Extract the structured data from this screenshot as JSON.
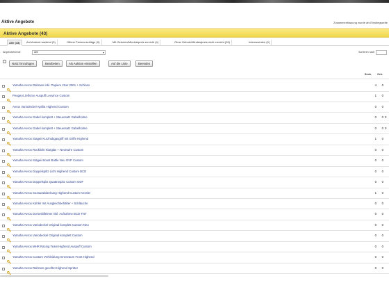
{
  "page": {
    "title": "Aktive Angebote",
    "summary_note": "Zusammenfassung wurde als Einstiegsseite"
  },
  "banner": {
    "title": "Aktive Angebote (43)"
  },
  "tabs": [
    {
      "label": "Alle (43)",
      "active": true
    },
    {
      "label": "Auf Antwort wartend (3)",
      "active": false
    },
    {
      "label": "Offene Preisvorschläge (0)",
      "active": false
    },
    {
      "label": "Mit Geboten/Mindestpreis erreicht (4)",
      "active": false
    },
    {
      "label": "Ohne Gebote/Mindestpreis nicht erreicht (39)",
      "active": false
    },
    {
      "label": "Interessenten (0)",
      "active": false
    }
  ],
  "filter": {
    "label": "Angebotsformat",
    "value": "Alle",
    "sort_label": "Sortieren nach"
  },
  "toolbar": {
    "buttons": [
      "Notiz hinzufügen",
      "Bearbeiten",
      "Als Auktion einstellen",
      "Auf die Liste",
      "Beenden"
    ]
  },
  "columns": {
    "bids": "Geb.",
    "watch": "Beob."
  },
  "listings": [
    {
      "title": "Yamaha Aerox Rahmen inkl. Papiere 2Ser 2001 + Schloss",
      "bids": "4",
      "watch": "0",
      "extra": ""
    },
    {
      "title": "Peugeot Jetforce Auspuff Leovince Custom",
      "bids": "1",
      "watch": "0",
      "extra": ""
    },
    {
      "title": "Aerox Variodeckel Aprilia Highend Custom",
      "bids": "0",
      "watch": "0",
      "extra": ""
    },
    {
      "title": "Yamaha Aerox Gabel komplett + Steuersatz Gabelholme",
      "bids": "0",
      "watch": "0",
      "extra": "0"
    },
    {
      "title": "Yamaha Aerox Gabel komplett + Steuersatz Gabelholme",
      "bids": "0",
      "watch": "0",
      "extra": "0"
    },
    {
      "title": "Yamaha Aerox Stageii Kurzhubgasgriff mit Griffe Highend",
      "bids": "1",
      "watch": "0",
      "extra": ""
    },
    {
      "title": "Yamaha Aerox Rücklicht Klarglas + Neonwire Custom",
      "bids": "0",
      "watch": "0",
      "extra": ""
    },
    {
      "title": "Yamaha Aerox Stageii Boost Bottle Neu OVP Custom",
      "bids": "0",
      "watch": "0",
      "extra": ""
    },
    {
      "title": "Yamaha Aerox Doppelspiltz Licht Highend Custom BCD",
      "bids": "0",
      "watch": "0",
      "extra": ""
    },
    {
      "title": "Yamaha Aerox Doppelspitz Quattrospitz Custom ODF",
      "bids": "0",
      "watch": "0",
      "extra": ""
    },
    {
      "title": "Yamaha Aerox Sozaurabdeckung Highend Custom Kessler",
      "bids": "1",
      "watch": "0",
      "extra": ""
    },
    {
      "title": "Yamaha Aerox Kühler mit Ausgleichbehälter + Schläuche",
      "bids": "0",
      "watch": "0",
      "extra": ""
    },
    {
      "title": "Yamaha Aerox Dorsetkilleimer inkl. Aufnahme BCD TNT",
      "bids": "0",
      "watch": "0",
      "extra": ""
    },
    {
      "title": "Yamaha Aerox Variodeckel Original komplett Custom Neu",
      "bids": "0",
      "watch": "0",
      "extra": ""
    },
    {
      "title": "Yamaha Aerox Variodeckel Original komplett Custom",
      "bids": "0",
      "watch": "0",
      "extra": ""
    },
    {
      "title": "Yamaha Aerox MHR Racing Team Highend Auspuff Custom",
      "bids": "0",
      "watch": "0",
      "extra": ""
    },
    {
      "title": "Yamaha Aerox Custom Verkleidung Innenraum Front Highend",
      "bids": "0",
      "watch": "0",
      "extra": ""
    },
    {
      "title": "Yamaha Aerox Rahmen gecoftet Highend Spritter",
      "bids": "0",
      "watch": "0",
      "extra": ""
    }
  ],
  "colors": {
    "banner": "#f2d64a",
    "link": "#2a3f8f",
    "key_icon": "#d6a21c"
  },
  "icons": {
    "row_icon": "key-icon",
    "filter_arrow": "chevron-down-icon"
  }
}
